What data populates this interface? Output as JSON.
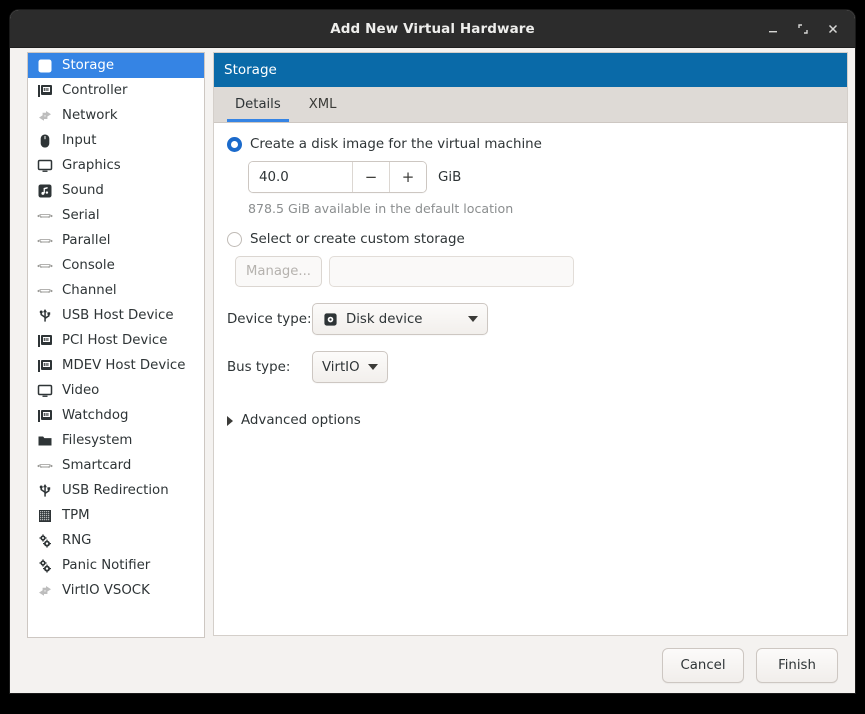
{
  "window": {
    "title": "Add New Virtual Hardware",
    "controls": [
      {
        "name": "minimize",
        "glyph": "minimize-icon"
      },
      {
        "name": "maximize",
        "glyph": "maximize-icon"
      },
      {
        "name": "close",
        "glyph": "close-icon"
      }
    ]
  },
  "colors": {
    "titlebar_bg": "#2c2c2c",
    "panel_header_bg": "#0a6aa8",
    "selection_blue": "#3584e4",
    "tab_underline": "#3584e4",
    "window_bg": "#f4f2f0",
    "tabbar_bg": "#dedad6"
  },
  "sidebar": {
    "items": [
      {
        "label": "Storage",
        "icon": "disk-icon",
        "selected": true
      },
      {
        "label": "Controller",
        "icon": "card-icon",
        "selected": false
      },
      {
        "label": "Network",
        "icon": "network-icon",
        "selected": false
      },
      {
        "label": "Input",
        "icon": "mouse-icon",
        "selected": false
      },
      {
        "label": "Graphics",
        "icon": "monitor-icon",
        "selected": false
      },
      {
        "label": "Sound",
        "icon": "sound-icon",
        "selected": false
      },
      {
        "label": "Serial",
        "icon": "port-icon",
        "selected": false
      },
      {
        "label": "Parallel",
        "icon": "port-icon",
        "selected": false
      },
      {
        "label": "Console",
        "icon": "port-icon",
        "selected": false
      },
      {
        "label": "Channel",
        "icon": "port-icon",
        "selected": false
      },
      {
        "label": "USB Host Device",
        "icon": "usb-icon",
        "selected": false
      },
      {
        "label": "PCI Host Device",
        "icon": "card-icon",
        "selected": false
      },
      {
        "label": "MDEV Host Device",
        "icon": "card-icon",
        "selected": false
      },
      {
        "label": "Video",
        "icon": "monitor-icon",
        "selected": false
      },
      {
        "label": "Watchdog",
        "icon": "card-icon",
        "selected": false
      },
      {
        "label": "Filesystem",
        "icon": "folder-icon",
        "selected": false
      },
      {
        "label": "Smartcard",
        "icon": "port-icon",
        "selected": false
      },
      {
        "label": "USB Redirection",
        "icon": "usb-icon",
        "selected": false
      },
      {
        "label": "TPM",
        "icon": "chip-icon",
        "selected": false
      },
      {
        "label": "RNG",
        "icon": "gears-icon",
        "selected": false
      },
      {
        "label": "Panic Notifier",
        "icon": "gears-icon",
        "selected": false
      },
      {
        "label": "VirtIO VSOCK",
        "icon": "network-icon",
        "selected": false
      }
    ]
  },
  "panel": {
    "header_title": "Storage",
    "tabs": [
      {
        "label": "Details",
        "active": true
      },
      {
        "label": "XML",
        "active": false
      }
    ],
    "details": {
      "create_radio_label": "Create a disk image for the virtual machine",
      "create_radio_selected": true,
      "size_value": "40.0",
      "size_decrement": "−",
      "size_increment": "+",
      "size_unit": "GiB",
      "available_text": "878.5 GiB available in the default location",
      "custom_radio_label": "Select or create custom storage",
      "custom_radio_selected": false,
      "manage_button_label": "Manage...",
      "custom_path_value": "",
      "custom_path_placeholder": "",
      "device_type_label": "Device type:",
      "device_type_value": "Disk device",
      "device_type_icon": "disk-icon",
      "bus_type_label": "Bus type:",
      "bus_type_value": "VirtIO",
      "advanced_options_label": "Advanced options",
      "advanced_expanded": false
    }
  },
  "footer": {
    "cancel_label": "Cancel",
    "finish_label": "Finish"
  }
}
